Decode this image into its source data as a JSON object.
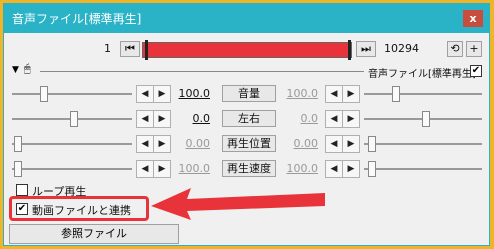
{
  "window": {
    "title": "音声ファイル[標準再生]",
    "close_label": "x"
  },
  "timeline": {
    "start": "1",
    "end": "10294",
    "start_btn": "⏮",
    "end_btn": "⏭"
  },
  "header": {
    "filter_name": "音声ファイル[標準再生]"
  },
  "params": [
    {
      "name": "音量",
      "left": "100.0",
      "right": "100.0",
      "enabled": true
    },
    {
      "name": "左右",
      "left": "0.0",
      "right": "0.0",
      "enabled": true
    },
    {
      "name": "再生位置",
      "left": "0.00",
      "right": "0.00",
      "enabled": false
    },
    {
      "name": "再生速度",
      "left": "100.0",
      "right": "100.0",
      "enabled": false
    }
  ],
  "options": {
    "loop": {
      "label": "ループ再生",
      "checked": false
    },
    "link_video": {
      "label": "動画ファイルと連携",
      "checked": true
    }
  },
  "ref_button": "参照ファイル",
  "colors": {
    "accent": "#2ab3c7",
    "highlight": "#e8333a",
    "frame_bg": "#f0b429"
  }
}
